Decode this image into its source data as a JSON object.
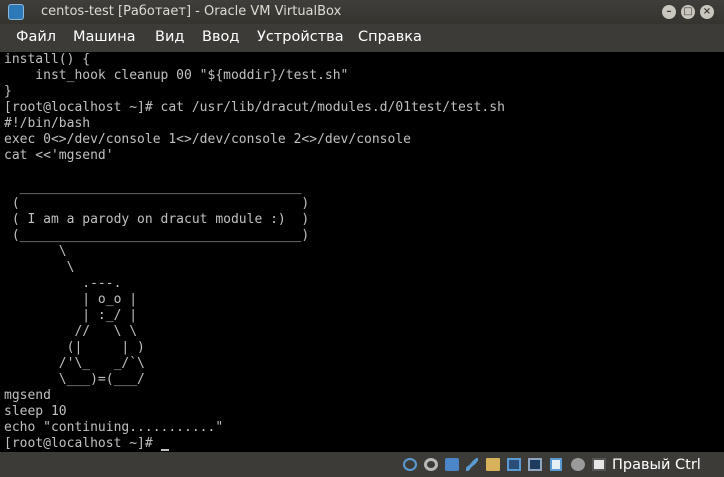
{
  "window": {
    "title": "centos-test [Работает] - Oracle VM VirtualBox",
    "controls": {
      "minimize": "–",
      "maximize": "□",
      "close": "×"
    }
  },
  "menu": [
    "Файл",
    "Машина",
    "Вид",
    "Ввод",
    "Устройства",
    "Справка"
  ],
  "terminal": {
    "lines": [
      "install() {",
      "    inst_hook cleanup 00 \"${moddir}/test.sh\"",
      "}",
      "[root@localhost ~]# cat /usr/lib/dracut/modules.d/01test/test.sh",
      "#!/bin/bash",
      "exec 0<>/dev/console 1<>/dev/console 2<>/dev/console",
      "cat <<'mgsend'",
      "",
      "  ____________________________________",
      " (                                    )",
      " ( I am a parody on dracut module :)  )",
      " (____________________________________)",
      "       \\",
      "        \\",
      "          .---.",
      "          | o_o |",
      "          | :_/ |",
      "         //   \\ \\",
      "        (|     | )",
      "       /'\\_   _/`\\",
      "       \\___)=(___/",
      "mgsend",
      "sleep 10",
      "echo \"continuing...........\"",
      "[root@localhost ~]# "
    ]
  },
  "status": {
    "icons": [
      "optical-drive-icon",
      "audio-icon",
      "network-icon",
      "usb-icon",
      "shared-folders-icon",
      "display-icon",
      "video-capture-icon",
      "recording-icon",
      "mouse-integration-icon",
      "keyboard-icon"
    ],
    "host_key": "Правый Ctrl"
  },
  "colors": {
    "terminal_text": "#c0c0c0",
    "terminal_bg": "#000000",
    "chrome_bg": "#3c3b37"
  }
}
